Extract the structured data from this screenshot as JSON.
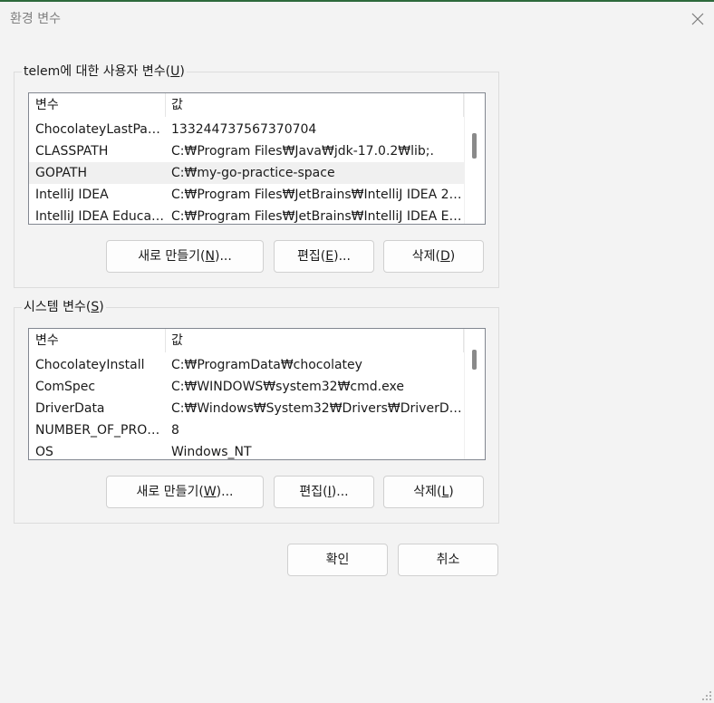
{
  "window": {
    "title": "환경 변수",
    "close_symbol": "✕"
  },
  "user_vars": {
    "label_prefix": "telem에 대한 사용자 변수(",
    "label_key": "U",
    "label_suffix": ")",
    "columns": [
      "변수",
      "값"
    ],
    "rows": [
      {
        "name": "ChocolateyLastPath...",
        "value": "133244737567370704"
      },
      {
        "name": "CLASSPATH",
        "value": "C:₩Program Files₩Java₩jdk-17.0.2₩lib;."
      },
      {
        "name": "GOPATH",
        "value": "C:₩my-go-practice-space",
        "selected": true
      },
      {
        "name": "IntelliJ IDEA",
        "value": "C:₩Program Files₩JetBrains₩IntelliJ IDEA 202..."
      },
      {
        "name": "IntelliJ IDEA Educat...",
        "value": "C:₩Program Files₩JetBrains₩IntelliJ IDEA Ed..."
      }
    ],
    "buttons": {
      "new": {
        "prefix": "새로 만들기(",
        "key": "N",
        "suffix": ")..."
      },
      "edit": {
        "prefix": "편집(",
        "key": "E",
        "suffix": ")..."
      },
      "delete": {
        "prefix": "삭제(",
        "key": "D",
        "suffix": ")"
      }
    }
  },
  "system_vars": {
    "label_prefix": "시스템 변수(",
    "label_key": "S",
    "label_suffix": ")",
    "columns": [
      "변수",
      "값"
    ],
    "rows": [
      {
        "name": "ChocolateyInstall",
        "value": "C:₩ProgramData₩chocolatey"
      },
      {
        "name": "ComSpec",
        "value": "C:₩WINDOWS₩system32₩cmd.exe"
      },
      {
        "name": "DriverData",
        "value": "C:₩Windows₩System32₩Drivers₩DriverData"
      },
      {
        "name": "NUMBER_OF_PROC...",
        "value": "8"
      },
      {
        "name": "OS",
        "value": "Windows_NT"
      }
    ],
    "buttons": {
      "new": {
        "prefix": "새로 만들기(",
        "key": "W",
        "suffix": ")..."
      },
      "edit": {
        "prefix": "편집(",
        "key": "I",
        "suffix": ")..."
      },
      "delete": {
        "prefix": "삭제(",
        "key": "L",
        "suffix": ")"
      }
    }
  },
  "footer": {
    "ok_label": "확인",
    "cancel_label": "취소"
  }
}
